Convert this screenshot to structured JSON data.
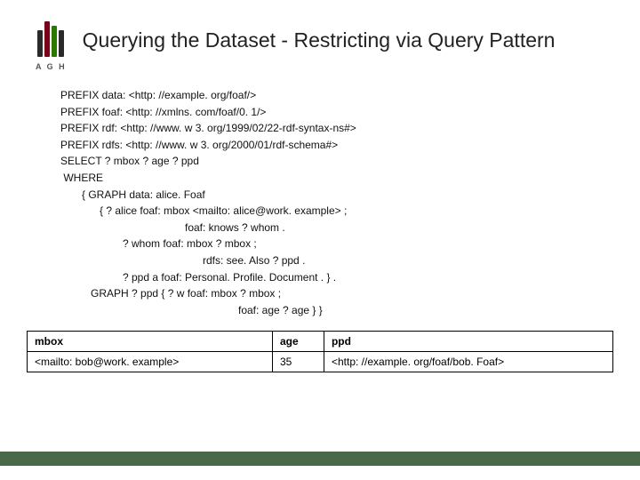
{
  "logo": {
    "text": "A G H"
  },
  "title": "Querying the Dataset  - Restricting via Query Pattern",
  "code": {
    "l1": "PREFIX data: <http: //example. org/foaf/>",
    "l2": "PREFIX foaf: <http: //xmlns. com/foaf/0. 1/>",
    "l3": "PREFIX rdf: <http: //www. w 3. org/1999/02/22-rdf-syntax-ns#>",
    "l4": "PREFIX rdfs: <http: //www. w 3. org/2000/01/rdf-schema#>",
    "l5": "SELECT ? mbox ? age ? ppd",
    "l6": " WHERE",
    "l7": "{ GRAPH data: alice. Foaf",
    "l8": "{ ? alice foaf: mbox <mailto: alice@work. example> ;",
    "l9": "foaf: knows ? whom .",
    "l10": "? whom foaf: mbox ? mbox ;",
    "l11": "rdfs: see. Also ? ppd .",
    "l12": "? ppd a foaf: Personal. Profile. Document . } .",
    "l13": "GRAPH ? ppd { ? w foaf: mbox ? mbox ;",
    "l14": "foaf: age ? age } }"
  },
  "table": {
    "headers": {
      "c1": "mbox",
      "c2": "age",
      "c3": "ppd"
    },
    "row1": {
      "c1": "<mailto: bob@work. example>",
      "c2": "35",
      "c3": "<http: //example. org/foaf/bob. Foaf>"
    }
  }
}
